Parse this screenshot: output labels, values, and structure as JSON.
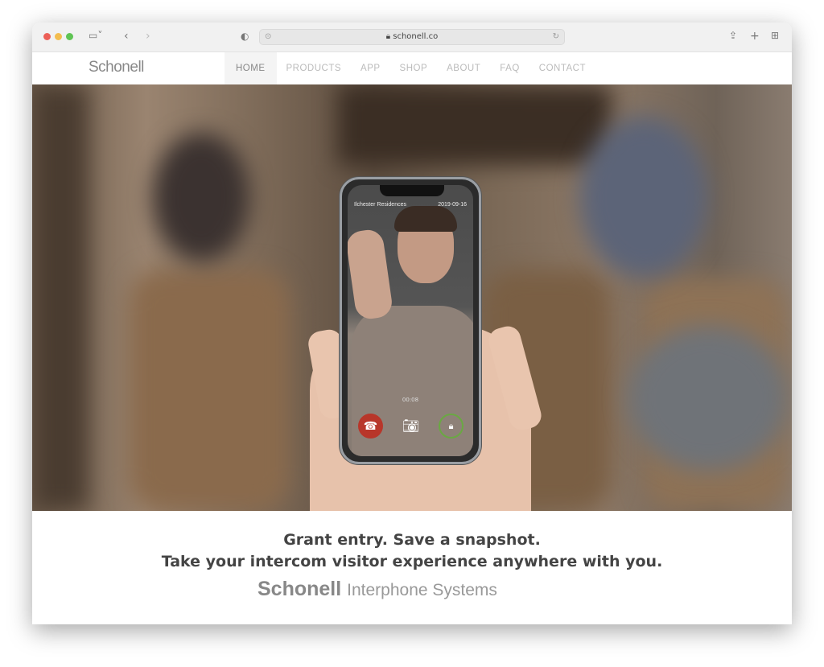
{
  "browser": {
    "url": "schonell.co",
    "icons": [
      "sidebar-icon",
      "back-icon",
      "forward-icon",
      "shield-icon",
      "share-icon",
      "new-tab-icon",
      "tab-overview-icon",
      "reload-icon",
      "lock-icon"
    ]
  },
  "nav": {
    "logo": "Schonell",
    "items": [
      {
        "label": "HOME",
        "active": true
      },
      {
        "label": "PRODUCTS"
      },
      {
        "label": "APP"
      },
      {
        "label": "SHOP"
      },
      {
        "label": "ABOUT"
      },
      {
        "label": "FAQ"
      },
      {
        "label": "CONTACT"
      }
    ]
  },
  "phone": {
    "location": "Ilchester Residences",
    "date": "2019-09-16",
    "timer": "00:08",
    "buttons": [
      "hang-up-icon",
      "camera-icon",
      "unlock-icon"
    ]
  },
  "headline": {
    "line1": "Grant entry. Save a snapshot.",
    "line2": "Take your intercom visitor experience anywhere with you."
  },
  "footer": {
    "brand": "Schonell",
    "tagline": "Interphone Systems"
  },
  "colors": {
    "hangup": "#b8362a",
    "unlock": "#6aa843",
    "text": "#444444"
  }
}
